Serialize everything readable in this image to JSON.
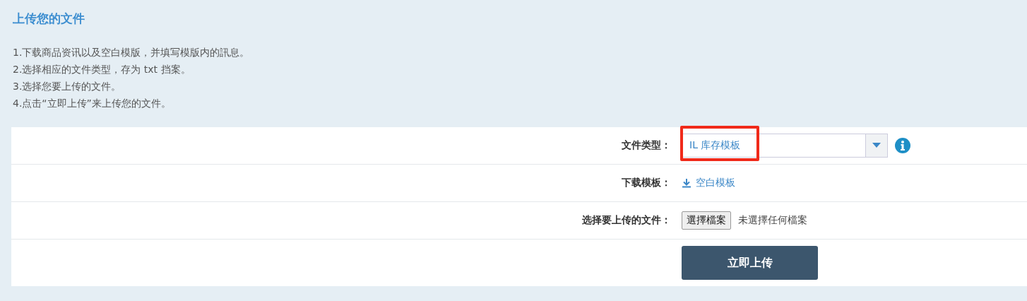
{
  "title": "上传您的文件",
  "instructions": [
    "1.下载商品资讯以及空白模版，并填写模版内的訊息。",
    "2.选择相应的文件类型，存为 txt 挡案。",
    "3.选择您要上传的文件。",
    "4.点击“立即上传”来上传您的文件。"
  ],
  "form": {
    "rows": [
      {
        "kind": "select",
        "label": "文件类型：",
        "value": "IL 库存模板",
        "highlighted": true
      },
      {
        "kind": "download",
        "label": "下载模板：",
        "link": "空白模板"
      },
      {
        "kind": "file",
        "label": "选择要上传的文件：",
        "button": "選擇檔案",
        "status": "未選擇任何檔案"
      },
      {
        "kind": "submit",
        "button": "立即上传"
      }
    ]
  }
}
